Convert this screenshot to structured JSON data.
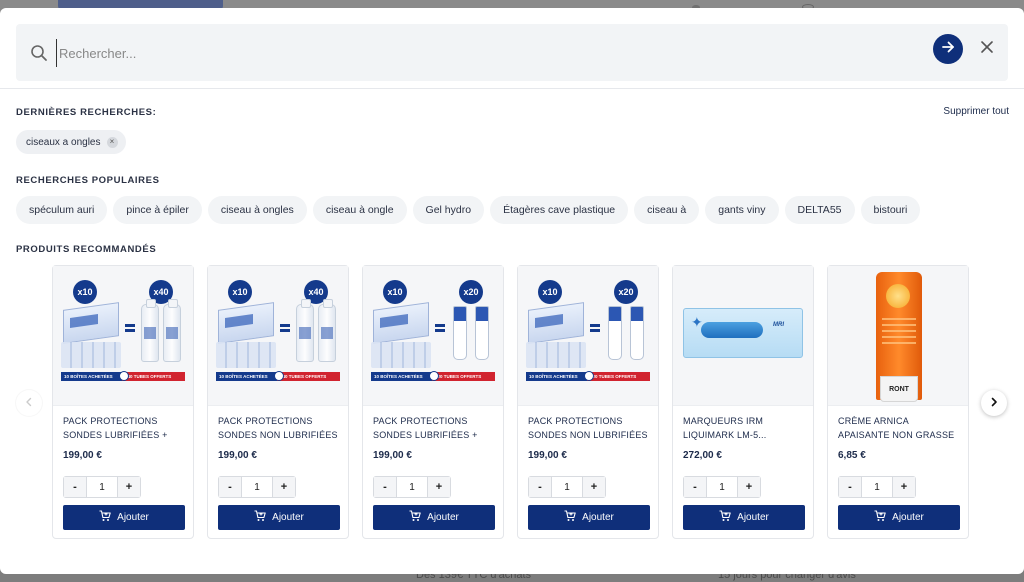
{
  "search": {
    "placeholder": "Rechercher..."
  },
  "recent": {
    "title": "DERNIÈRES RECHERCHES:",
    "clear_all": "Supprimer tout",
    "items": [
      "ciseaux a ongles"
    ]
  },
  "popular": {
    "title": "RECHERCHES POPULAIRES",
    "items": [
      "spéculum auri",
      "pince à épiler",
      "ciseau à ongles",
      "ciseau à ongle",
      "Gel hydro",
      "Étagères cave plastique",
      "ciseau à",
      "gants viny",
      "DELTA55",
      "bistouri"
    ]
  },
  "products": {
    "title": "PRODUITS RECOMMANDÉS",
    "add_label": "Ajouter",
    "items": [
      {
        "name": "PACK PROTECTIONS SONDES LUBRIFIÉES + GE...",
        "price": "199,00 €",
        "qty": "1",
        "badge_left": "x10",
        "badge_right": "x40",
        "strip_left": "10 BOÎTES ACHETÉES",
        "strip_right": "40 TUBES OFFERTS",
        "image": "bottles"
      },
      {
        "name": "PACK PROTECTIONS SONDES NON LUBRIFIÉES ...",
        "price": "199,00 €",
        "qty": "1",
        "badge_left": "x10",
        "badge_right": "x40",
        "strip_left": "10 BOÎTES ACHETÉES",
        "strip_right": "40 TUBES OFFERTS",
        "image": "bottles"
      },
      {
        "name": "PACK PROTECTIONS SONDES LUBRIFIÉES + GE...",
        "price": "199,00 €",
        "qty": "1",
        "badge_left": "x10",
        "badge_right": "x20",
        "strip_left": "10 BOÎTES ACHETÉES",
        "strip_right": "20 TUBES OFFERTS",
        "image": "tubes"
      },
      {
        "name": "PACK PROTECTIONS SONDES NON LUBRIFIÉES ...",
        "price": "199,00 €",
        "qty": "1",
        "badge_left": "x10",
        "badge_right": "x20",
        "strip_left": "10 BOÎTES ACHETÉES",
        "strip_right": "20 TUBES OFFERTS",
        "image": "tubes"
      },
      {
        "name": "MARQUEURS IRM LIQUIMARK LM-5...",
        "price": "272,00 €",
        "qty": "1",
        "image": "marker",
        "image_label": "MRI"
      },
      {
        "name": "CRÈME ARNICA APAISANTE NON GRASSE RONT - tube...",
        "price": "6,85 €",
        "qty": "1",
        "image": "cream",
        "image_label": "RONT"
      }
    ]
  },
  "colors": {
    "primary": "#0f2f7a",
    "chip_bg": "#f2f4f6",
    "text": "#1c2a4a"
  },
  "background": {
    "footer_left": "Des 139€ TTC d'achats",
    "footer_right": "15 jours pour changer d'avis"
  }
}
